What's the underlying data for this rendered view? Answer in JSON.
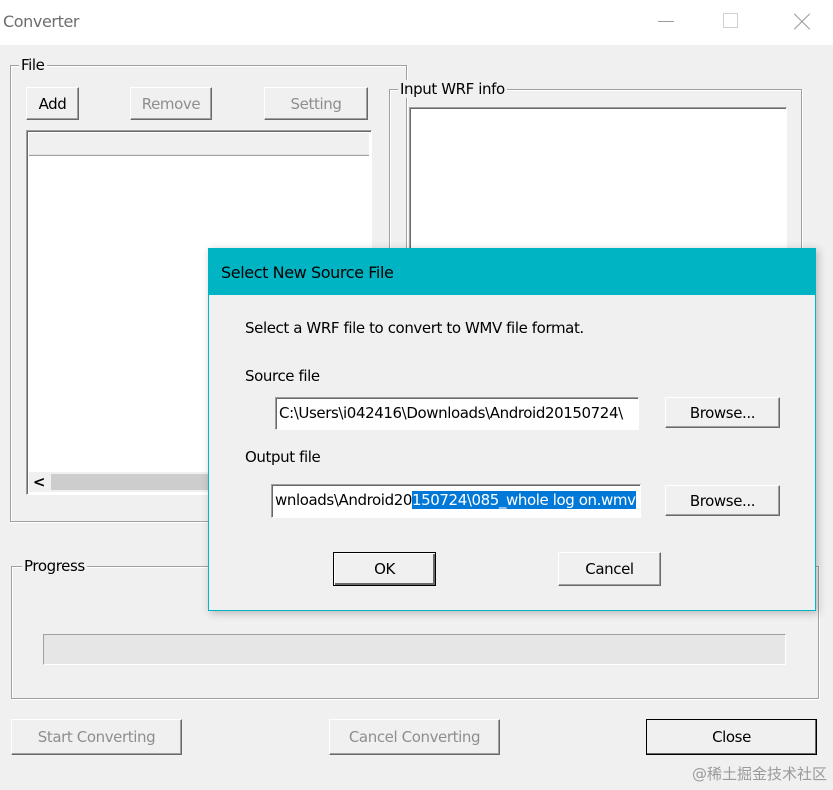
{
  "window": {
    "title": "Converter"
  },
  "file_group": {
    "label": "File",
    "add_label": "Add",
    "remove_label": "Remove",
    "setting_label": "Setting"
  },
  "input_info_group": {
    "label": "Input WRF info"
  },
  "progress_group": {
    "label": "Progress",
    "progress_value": 0
  },
  "bottom_buttons": {
    "start_label": "Start Converting",
    "cancel_label": "Cancel Converting",
    "close_label": "Close"
  },
  "dialog": {
    "title": "Select New Source File",
    "description": "Select a WRF file to convert to WMV file format.",
    "source_label": "Source file",
    "source_value": "C:\\Users\\i042416\\Downloads\\Android20150724\\",
    "browse_label_1": "Browse...",
    "output_label": "Output file",
    "output_value_plain": "wnloads\\Android20",
    "output_value_selected": "150724\\085_whole log on.wmv",
    "browse_label_2": "Browse...",
    "ok_label": "OK",
    "cancel_label": "Cancel",
    "accent_color": "#00b4c4"
  },
  "watermark": {
    "text": "@稀土掘金技术社区"
  }
}
